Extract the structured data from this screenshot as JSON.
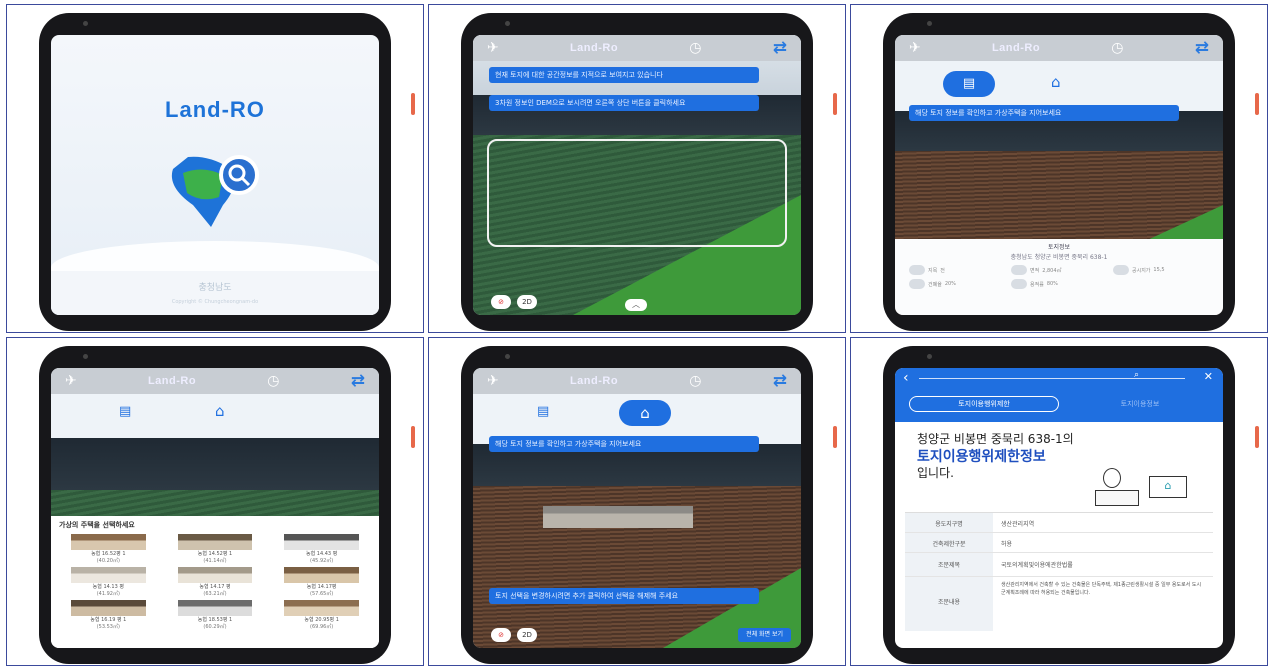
{
  "cells": {
    "splash": {
      "title": "Land-RO",
      "footer": "충청남도",
      "footer_sub": "Copyright © Chungcheongnam-do"
    },
    "p2": {
      "app_title": "Land-Ro",
      "bubble1": "현재 토지에 대한 공간정보를 지적으로 보여지고 있습니다",
      "bubble2": "3차원 정보인 DEM으로 보시려면 오른쪽 상단 버튼을 클릭하세요",
      "btn_2d": "2D",
      "btn_up": "︿"
    },
    "p3": {
      "app_title": "Land-Ro",
      "bubble": "해당 토지 정보를 확인하고 가상주택을 지어보세요",
      "panel_title": "토지정보",
      "address": "충청남도 청양군 비봉면 중묵리 638-1",
      "items": [
        {
          "k": "지목",
          "v": "전"
        },
        {
          "k": "면적",
          "v": "2,804㎡"
        },
        {
          "k": "공시지가",
          "v": "15,5"
        },
        {
          "k": "건폐율",
          "v": "20%"
        },
        {
          "k": "용적률",
          "v": "80%"
        }
      ]
    },
    "p4": {
      "app_title": "Land-Ro",
      "choose": "가상의 주택을 선택하세요",
      "houses": [
        {
          "name": "농협 16.52평 1",
          "size": "(40.20㎡)"
        },
        {
          "name": "농협 14.52평 1",
          "size": "(41.14㎡)"
        },
        {
          "name": "농협 14.43 평",
          "size": "(45.92㎡)"
        },
        {
          "name": "농협 14.13 평",
          "size": "(41.92㎡)"
        },
        {
          "name": "농협 14.17 평",
          "size": "(63.21㎡)"
        },
        {
          "name": "농협 14.17평",
          "size": "(57.65㎡)"
        },
        {
          "name": "농협 16.19 평 1",
          "size": "(53.53㎡)"
        },
        {
          "name": "농협 18.53평 1",
          "size": "(60.29㎡)"
        },
        {
          "name": "농협 20.95평 1",
          "size": "(69.96㎡)"
        }
      ]
    },
    "p5": {
      "app_title": "Land-Ro",
      "bubble_top": "해당 토지 정보를 확인하고 가상주택을 지어보세요",
      "bubble_bottom": "토지 선택을 변경하시려면 추가 클릭하여 선택을 해제해 주세요",
      "btn_2d": "2D",
      "btn_detail": "전체 화면 보기"
    },
    "p6": {
      "tab1": "토지이용행위제한",
      "tab2": "토지이용정보",
      "line1": "청양군 비봉면 중묵리 638-1의",
      "line2": "토지이용행위제한정보",
      "line3": "입니다.",
      "table": [
        {
          "k": "용도지구명",
          "v": "생산관리지역"
        },
        {
          "k": "건축제한구분",
          "v": "허용"
        },
        {
          "k": "조문제목",
          "v": "국토의계획및이용에관한법률"
        },
        {
          "k": "조문내용",
          "v": "생산관리지역에서 건축할 수 있는 건축물은 단독주택, 제1종근린생활시설 중 일부 용도로서 도시군계획조례에 따라 허용되는 건축물입니다."
        }
      ]
    }
  },
  "colors": {
    "accent": "#1f6fe0",
    "frame": "#3b4a9c",
    "side_button": "#e7684a"
  }
}
